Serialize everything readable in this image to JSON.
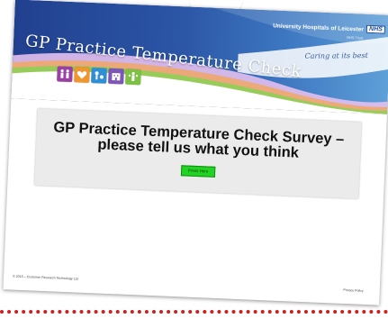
{
  "header": {
    "title": "GP Practice Temperature Check",
    "organisation": "University Hospitals of Leicester",
    "organisation_sub": "NHS Trust",
    "nhs_logo": "NHS",
    "tagline": "Caring at its best",
    "icons": [
      "people-icon",
      "heart-icon",
      "stethoscope-icon",
      "building-icon",
      "group-icon"
    ],
    "icon_colors": [
      "#9b3fa5",
      "#f0962c",
      "#2f8fd6",
      "#7d55b8",
      "#7dc043"
    ]
  },
  "main": {
    "survey_heading": "GP Practice Temperature Check Survey – please tell us what you think",
    "press_button_label": "Press Here",
    "press_button_color": "#23d323"
  },
  "footer": {
    "copyright": "© 2015 – Customer Research Technology Ltd",
    "privacy_link": "Privacy Policy"
  }
}
